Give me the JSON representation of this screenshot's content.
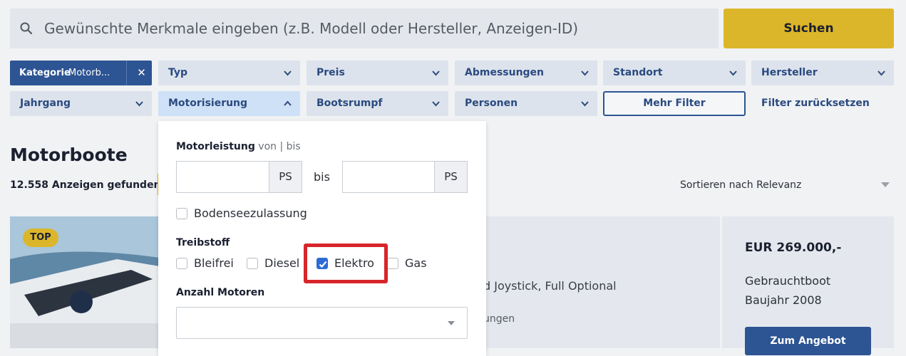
{
  "search": {
    "placeholder": "Gewünschte Merkmale eingeben (z.B. Modell oder Hersteller, Anzeigen-ID)",
    "button_label": "Suchen"
  },
  "filters": {
    "category": {
      "label": "Kategorie",
      "value": "Motorb..."
    },
    "row1": [
      "Typ",
      "Preis",
      "Abmessungen",
      "Standort",
      "Hersteller"
    ],
    "row2": [
      "Jahrgang",
      "Motorisierung",
      "Bootsrumpf",
      "Personen"
    ],
    "more_label": "Mehr Filter",
    "reset_label": "Filter zurücksetzen"
  },
  "page": {
    "title": "Motorboote",
    "result_count": "12.558 Anzeigen gefunden",
    "sort_label": "Sortieren nach",
    "sort_value": "Relevanz"
  },
  "listing": {
    "badge": "TOP",
    "partial_text_1": "d Joystick, Full Optional",
    "partial_text_2": "ungen",
    "price": "EUR 269.000,-",
    "condition": "Gebrauchtboot",
    "year": "Baujahr 2008",
    "offer_button": "Zum Angebot"
  },
  "panel": {
    "power_label": "Motorleistung",
    "power_sub": "von | bis",
    "unit": "PS",
    "bis": "bis",
    "bodensee_label": "Bodenseezulassung",
    "fuel_label": "Treibstoff",
    "fuels": [
      {
        "label": "Bleifrei",
        "checked": false
      },
      {
        "label": "Diesel",
        "checked": false
      },
      {
        "label": "Elektro",
        "checked": true
      },
      {
        "label": "Gas",
        "checked": false
      }
    ],
    "engines_label": "Anzahl Motoren"
  },
  "colors": {
    "brand_blue": "#2d5493",
    "accent_yellow": "#dcb62a",
    "highlight_red": "#d7262a"
  }
}
